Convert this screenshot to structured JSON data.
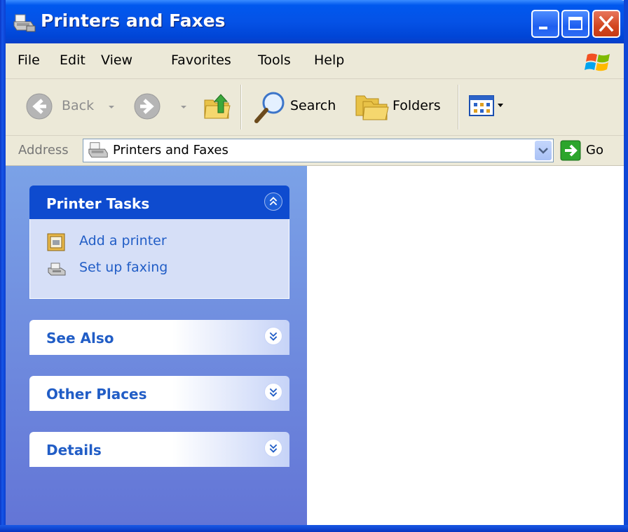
{
  "window": {
    "title": "Printers and Faxes",
    "accent": "#0054e3"
  },
  "menu": {
    "items": [
      {
        "label": "File"
      },
      {
        "label": "Edit"
      },
      {
        "label": "View"
      },
      {
        "label": "Favorites"
      },
      {
        "label": "Tools"
      },
      {
        "label": "Help"
      }
    ]
  },
  "toolbar": {
    "back_label": "Back",
    "search_label": "Search",
    "folders_label": "Folders",
    "icons": [
      "back-arrow-icon",
      "forward-arrow-icon",
      "folder-up-icon",
      "search-magnifier-icon",
      "folders-icon",
      "views-icon"
    ]
  },
  "address": {
    "label": "Address",
    "value": "Printers and Faxes",
    "go_label": "Go"
  },
  "taskpane": {
    "printer_tasks": {
      "title": "Printer Tasks",
      "expanded": true,
      "items": [
        {
          "label": "Add a printer",
          "icon": "add-printer-icon"
        },
        {
          "label": "Set up faxing",
          "icon": "fax-icon"
        }
      ]
    },
    "see_also": {
      "title": "See Also",
      "expanded": false
    },
    "other_places": {
      "title": "Other Places",
      "expanded": false
    },
    "details": {
      "title": "Details",
      "expanded": false
    }
  }
}
